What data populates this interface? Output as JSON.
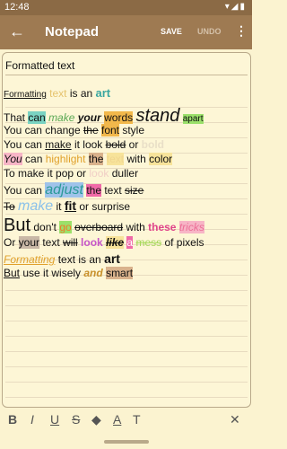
{
  "status_bar": {
    "time": "12:48",
    "icons": "▾◢▮"
  },
  "app_bar": {
    "back_icon": "arrow-left-icon",
    "title": "Notepad",
    "save_label": "SAVE",
    "undo_label": "UNDO",
    "more_icon": "more-vert-icon"
  },
  "note": {
    "title": "Formatted text",
    "lines": [
      [
        "Formatting",
        " text",
        " is an ",
        "art"
      ],
      [
        "That ",
        "can",
        " ",
        "make",
        " ",
        "your",
        " ",
        "words",
        " ",
        "stand",
        " ",
        "apart"
      ],
      [
        "You can change ",
        "the",
        " ",
        "font",
        " style"
      ],
      [
        "You can ",
        "make",
        " it look ",
        "bold",
        " or ",
        "bold"
      ],
      [
        "You",
        " can ",
        "highlight",
        " ",
        "the",
        " ",
        "text",
        " with ",
        "color"
      ],
      [
        "To make it pop or ",
        "look",
        " duller"
      ],
      [
        "You can ",
        "adjust",
        " ",
        "the",
        " text ",
        "size"
      ],
      [
        "To",
        " ",
        "make",
        " it ",
        "fit",
        " or surprise"
      ],
      [
        "But",
        " don't ",
        "go",
        " ",
        "overboard",
        " with ",
        "these",
        " ",
        "tricks"
      ],
      [
        "Or ",
        "your",
        " text ",
        "will",
        " ",
        "look",
        " ",
        "like",
        " ",
        "a",
        " ",
        "mess",
        " of pixels"
      ],
      [
        "Formatting",
        " text is an ",
        "art"
      ],
      [
        "But",
        " use it wisely ",
        "and",
        " ",
        "smart"
      ]
    ]
  },
  "toolbar": {
    "bold_icon": "B",
    "italic_icon": "I",
    "underline_icon": "U",
    "strikethrough_icon": "S",
    "fill_icon": "◆",
    "text_color_icon": "A",
    "text_size_icon": "T",
    "clear_icon": "✕"
  }
}
